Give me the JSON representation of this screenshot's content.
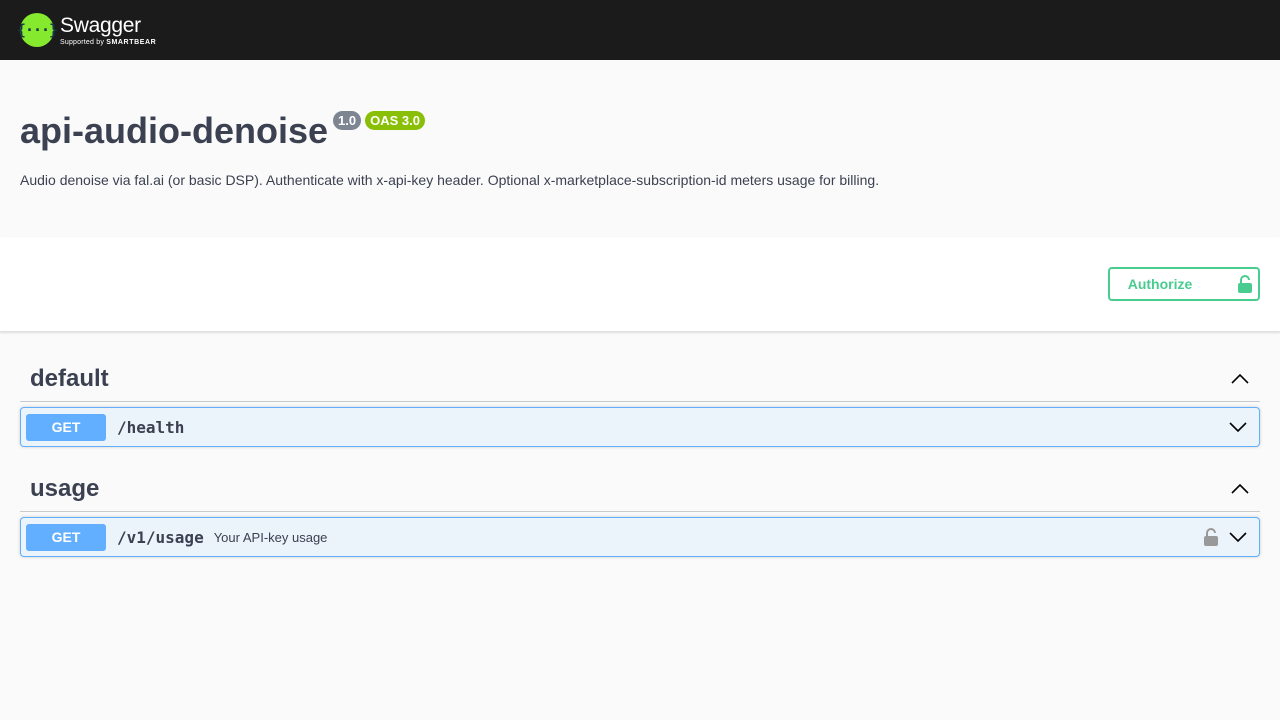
{
  "topbar": {
    "logo_name": "Swagger",
    "logo_sub_prefix": "Supported by ",
    "logo_sub_brand": "SMARTBEAR",
    "logo_mark": "{···}"
  },
  "info": {
    "title": "api-audio-denoise",
    "version": "1.0",
    "oas": "OAS 3.0",
    "description": "Audio denoise via fal.ai (or basic DSP). Authenticate with x-api-key header. Optional x-marketplace-subscription-id meters usage for billing."
  },
  "scheme": {
    "authorize_label": "Authorize"
  },
  "tags": [
    {
      "name": "default",
      "operations": [
        {
          "method": "GET",
          "path": "/health",
          "summary": ""
        }
      ]
    },
    {
      "name": "usage",
      "operations": [
        {
          "method": "GET",
          "path": "/v1/usage",
          "summary": "Your API-key usage"
        }
      ]
    }
  ],
  "colors": {
    "topbar": "#1b1b1b",
    "logo_green": "#85ea2d",
    "authorize": "#49cc90",
    "get": "#61affe",
    "get_bg": "#ebf3fb",
    "badge_version": "#7d8492",
    "badge_oas": "#89bf04"
  },
  "icons": {
    "authorize": "unlocked-padlock-icon",
    "lock": "lock-icon",
    "collapse": "chevron-up-icon",
    "expand": "chevron-down-icon"
  }
}
